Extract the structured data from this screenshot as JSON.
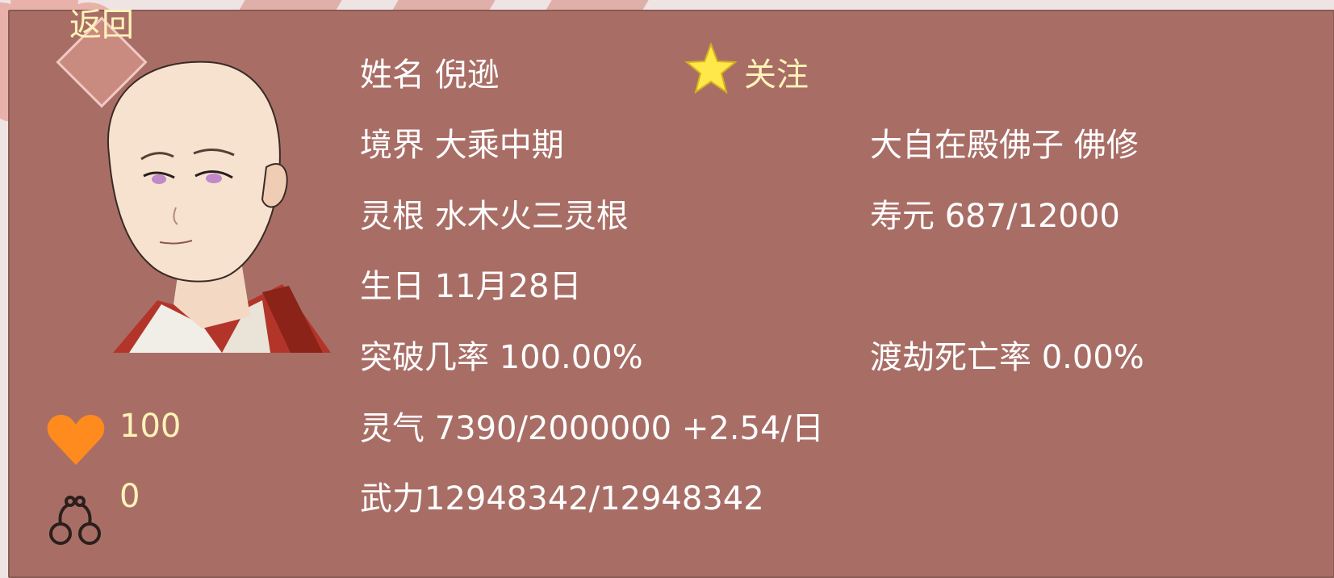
{
  "nav": {
    "back_label": "返回"
  },
  "profile": {
    "name": "姓名 倪逊",
    "follow_label": "关注",
    "realm": "境界 大乘中期",
    "title": "大自在殿佛子  佛修",
    "spirit_root": "灵根 水木火三灵根",
    "lifespan": "寿元 687/12000",
    "birthday": "生日 11月28日",
    "breakthrough": "突破几率 100.00%",
    "tribulation": "渡劫死亡率 0.00%",
    "qi": "灵气 7390/2000000 +2.54/日",
    "power": "武力12948342/12948342"
  },
  "stats": {
    "favor": "100",
    "shackles": "0"
  },
  "colors": {
    "panel": "#a86e66",
    "gold_text": "#fff3b8",
    "heart": "#ff8a1e"
  },
  "icons": {
    "follow": "star-icon",
    "favor": "heart-icon",
    "shackles": "handcuffs-icon"
  }
}
